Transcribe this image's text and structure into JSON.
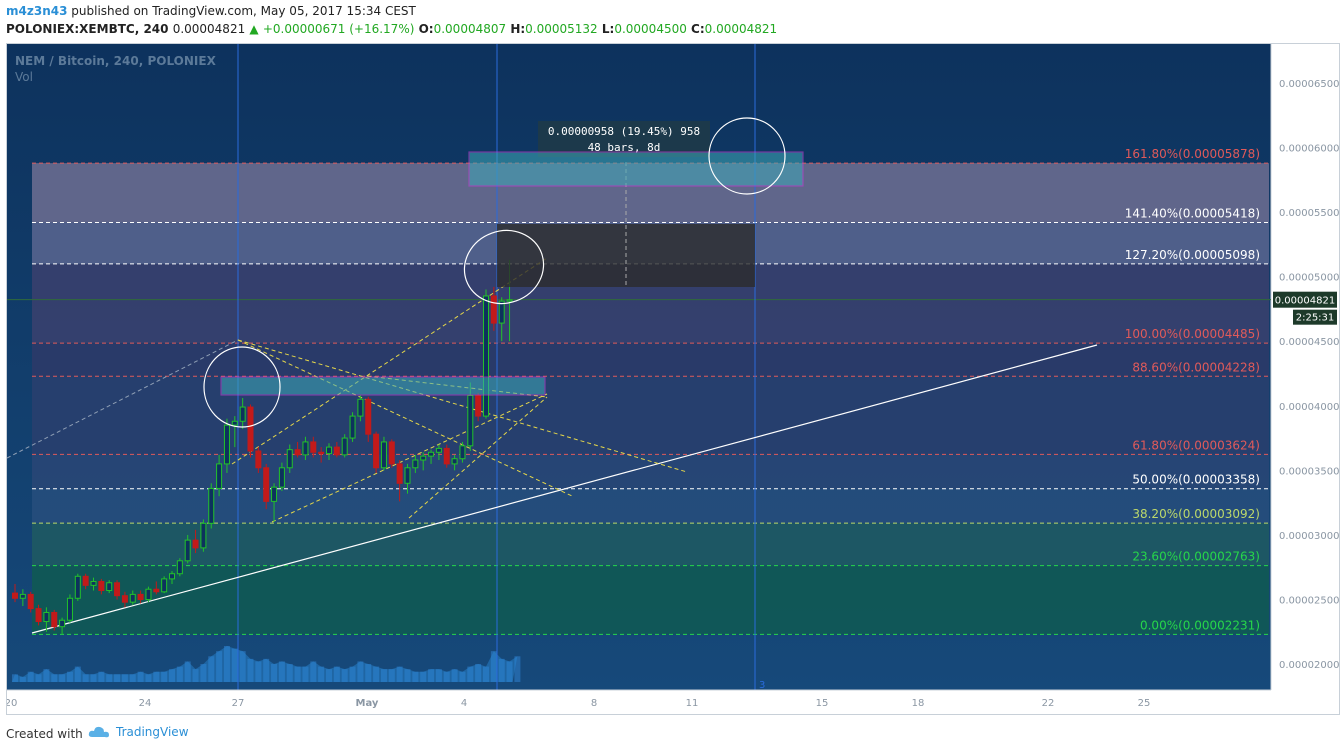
{
  "header": {
    "user": "m4z3n43",
    "published_text": "published on TradingView.com, May 05, 2017 15:34 CEST",
    "symbol": "POLONIEX:XEMBTC, 240",
    "last": "0.00004821",
    "change": "+0.00000671 (+16.17%)",
    "o_label": "O:",
    "o_value": "0.00004807",
    "h_label": "H:",
    "h_value": "0.00005132",
    "l_label": "L:",
    "l_value": "0.00004500",
    "c_label": "C:",
    "c_value": "0.00004821"
  },
  "chart": {
    "title": "NEM / Bitcoin, 240, POLONIEX",
    "vol_label": "Vol",
    "price_badge": "0.00004821",
    "timer_badge": "2:25:31",
    "measure_line1": "0.00000958 (19.45%) 958",
    "measure_line2": "48 bars, 8d",
    "marker_3": "3"
  },
  "colors": {
    "background": "#0f3a66",
    "up_candle": "#22c22a",
    "down_candle": "#c21a1a",
    "fib_red": "#e05a5a",
    "fib_white": "#ffffff",
    "fib_green": "#26d64a",
    "vertical_line": "#2a6bdb",
    "box_magenta": "#c83ad6",
    "trend_yellow": "#e6d84a"
  },
  "footer": {
    "created_with": "Created with",
    "brand": "TradingView"
  },
  "chart_data": {
    "type": "candlestick",
    "title": "NEM / Bitcoin, 240, POLONIEX",
    "x_ticks": [
      "20",
      "24",
      "27",
      "May",
      "4",
      "8",
      "11",
      "15",
      "18",
      "22",
      "25"
    ],
    "y_ticks": [
      "0.00006500",
      "0.00006000",
      "0.00005500",
      "0.00005000",
      "0.00004500",
      "0.00004000",
      "0.00003500",
      "0.00003000",
      "0.00002500",
      "0.00002000"
    ],
    "y_range": [
      1.8e-05,
      6.8e-05
    ],
    "fib_levels": [
      {
        "label": "161.80%(0.00005878)",
        "value": 5.878e-05,
        "color": "#e05a5a"
      },
      {
        "label": "141.40%(0.00005418)",
        "value": 5.418e-05,
        "color": "#ffffff"
      },
      {
        "label": "127.20%(0.00005098)",
        "value": 5.098e-05,
        "color": "#ffffff"
      },
      {
        "label": "100.00%(0.00004485)",
        "value": 4.485e-05,
        "color": "#e05a5a"
      },
      {
        "label": "88.60%(0.00004228)",
        "value": 4.228e-05,
        "color": "#e05a5a"
      },
      {
        "label": "61.80%(0.00003624)",
        "value": 3.624e-05,
        "color": "#e05a5a"
      },
      {
        "label": "50.00%(0.00003358)",
        "value": 3.358e-05,
        "color": "#ffffff"
      },
      {
        "label": "38.20%(0.00003092)",
        "value": 3.092e-05,
        "color": "#bcd86a"
      },
      {
        "label": "23.60%(0.00002763)",
        "value": 2.763e-05,
        "color": "#26d64a"
      },
      {
        "label": "0.00%(0.00002231)",
        "value": 2.231e-05,
        "color": "#26d64a"
      }
    ],
    "last_close": 4.821e-05,
    "candles": [
      {
        "o": 2.55e-05,
        "h": 2.62e-05,
        "l": 2.48e-05,
        "c": 2.51e-05
      },
      {
        "o": 2.51e-05,
        "h": 2.58e-05,
        "l": 2.45e-05,
        "c": 2.54e-05
      },
      {
        "o": 2.54e-05,
        "h": 2.56e-05,
        "l": 2.4e-05,
        "c": 2.43e-05
      },
      {
        "o": 2.43e-05,
        "h": 2.46e-05,
        "l": 2.3e-05,
        "c": 2.33e-05
      },
      {
        "o": 2.33e-05,
        "h": 2.44e-05,
        "l": 2.25e-05,
        "c": 2.4e-05
      },
      {
        "o": 2.4e-05,
        "h": 2.42e-05,
        "l": 2.26e-05,
        "c": 2.29e-05
      },
      {
        "o": 2.29e-05,
        "h": 2.36e-05,
        "l": 2.23e-05,
        "c": 2.34e-05
      },
      {
        "o": 2.34e-05,
        "h": 2.54e-05,
        "l": 2.32e-05,
        "c": 2.51e-05
      },
      {
        "o": 2.51e-05,
        "h": 2.7e-05,
        "l": 2.49e-05,
        "c": 2.68e-05
      },
      {
        "o": 2.68e-05,
        "h": 2.7e-05,
        "l": 2.58e-05,
        "c": 2.61e-05
      },
      {
        "o": 2.61e-05,
        "h": 2.67e-05,
        "l": 2.57e-05,
        "c": 2.64e-05
      },
      {
        "o": 2.64e-05,
        "h": 2.66e-05,
        "l": 2.54e-05,
        "c": 2.57e-05
      },
      {
        "o": 2.57e-05,
        "h": 2.65e-05,
        "l": 2.55e-05,
        "c": 2.63e-05
      },
      {
        "o": 2.63e-05,
        "h": 2.65e-05,
        "l": 2.5e-05,
        "c": 2.53e-05
      },
      {
        "o": 2.53e-05,
        "h": 2.56e-05,
        "l": 2.44e-05,
        "c": 2.48e-05
      },
      {
        "o": 2.48e-05,
        "h": 2.57e-05,
        "l": 2.46e-05,
        "c": 2.54e-05
      },
      {
        "o": 2.54e-05,
        "h": 2.57e-05,
        "l": 2.47e-05,
        "c": 2.5e-05
      },
      {
        "o": 2.5e-05,
        "h": 2.6e-05,
        "l": 2.48e-05,
        "c": 2.58e-05
      },
      {
        "o": 2.58e-05,
        "h": 2.64e-05,
        "l": 2.54e-05,
        "c": 2.56e-05
      },
      {
        "o": 2.56e-05,
        "h": 2.68e-05,
        "l": 2.55e-05,
        "c": 2.66e-05
      },
      {
        "o": 2.66e-05,
        "h": 2.72e-05,
        "l": 2.62e-05,
        "c": 2.7e-05
      },
      {
        "o": 2.7e-05,
        "h": 2.82e-05,
        "l": 2.68e-05,
        "c": 2.8e-05
      },
      {
        "o": 2.8e-05,
        "h": 3e-05,
        "l": 2.78e-05,
        "c": 2.96e-05
      },
      {
        "o": 2.96e-05,
        "h": 3.04e-05,
        "l": 2.86e-05,
        "c": 2.9e-05
      },
      {
        "o": 2.9e-05,
        "h": 3.12e-05,
        "l": 2.87e-05,
        "c": 3.09e-05
      },
      {
        "o": 3.09e-05,
        "h": 3.4e-05,
        "l": 3.05e-05,
        "c": 3.36e-05
      },
      {
        "o": 3.36e-05,
        "h": 3.62e-05,
        "l": 3.3e-05,
        "c": 3.55e-05
      },
      {
        "o": 3.55e-05,
        "h": 3.9e-05,
        "l": 3.48e-05,
        "c": 3.85e-05
      },
      {
        "o": 3.85e-05,
        "h": 3.92e-05,
        "l": 3.68e-05,
        "c": 3.88e-05
      },
      {
        "o": 3.88e-05,
        "h": 4.06e-05,
        "l": 3.82e-05,
        "c": 3.99e-05
      },
      {
        "o": 3.99e-05,
        "h": 4.01e-05,
        "l": 3.6e-05,
        "c": 3.65e-05
      },
      {
        "o": 3.65e-05,
        "h": 3.68e-05,
        "l": 3.48e-05,
        "c": 3.52e-05
      },
      {
        "o": 3.52e-05,
        "h": 3.55e-05,
        "l": 3.2e-05,
        "c": 3.26e-05
      },
      {
        "o": 3.26e-05,
        "h": 3.4e-05,
        "l": 3.1e-05,
        "c": 3.37e-05
      },
      {
        "o": 3.37e-05,
        "h": 3.56e-05,
        "l": 3.34e-05,
        "c": 3.52e-05
      },
      {
        "o": 3.52e-05,
        "h": 3.7e-05,
        "l": 3.48e-05,
        "c": 3.66e-05
      },
      {
        "o": 3.66e-05,
        "h": 3.72e-05,
        "l": 3.6e-05,
        "c": 3.62e-05
      },
      {
        "o": 3.62e-05,
        "h": 3.76e-05,
        "l": 3.58e-05,
        "c": 3.72e-05
      },
      {
        "o": 3.72e-05,
        "h": 3.76e-05,
        "l": 3.6e-05,
        "c": 3.64e-05
      },
      {
        "o": 3.64e-05,
        "h": 3.68e-05,
        "l": 3.56e-05,
        "c": 3.63e-05
      },
      {
        "o": 3.63e-05,
        "h": 3.71e-05,
        "l": 3.58e-05,
        "c": 3.68e-05
      },
      {
        "o": 3.68e-05,
        "h": 3.72e-05,
        "l": 3.6e-05,
        "c": 3.62e-05
      },
      {
        "o": 3.62e-05,
        "h": 3.78e-05,
        "l": 3.6e-05,
        "c": 3.75e-05
      },
      {
        "o": 3.75e-05,
        "h": 3.95e-05,
        "l": 3.72e-05,
        "c": 3.92e-05
      },
      {
        "o": 3.92e-05,
        "h": 4.08e-05,
        "l": 3.88e-05,
        "c": 4.05e-05
      },
      {
        "o": 4.05e-05,
        "h": 4.07e-05,
        "l": 3.72e-05,
        "c": 3.78e-05
      },
      {
        "o": 3.78e-05,
        "h": 3.8e-05,
        "l": 3.48e-05,
        "c": 3.52e-05
      },
      {
        "o": 3.52e-05,
        "h": 3.76e-05,
        "l": 3.5e-05,
        "c": 3.72e-05
      },
      {
        "o": 3.72e-05,
        "h": 3.74e-05,
        "l": 3.52e-05,
        "c": 3.55e-05
      },
      {
        "o": 3.55e-05,
        "h": 3.58e-05,
        "l": 3.26e-05,
        "c": 3.4e-05
      },
      {
        "o": 3.4e-05,
        "h": 3.55e-05,
        "l": 3.32e-05,
        "c": 3.52e-05
      },
      {
        "o": 3.52e-05,
        "h": 3.62e-05,
        "l": 3.48e-05,
        "c": 3.58e-05
      },
      {
        "o": 3.58e-05,
        "h": 3.64e-05,
        "l": 3.5e-05,
        "c": 3.61e-05
      },
      {
        "o": 3.61e-05,
        "h": 3.66e-05,
        "l": 3.55e-05,
        "c": 3.64e-05
      },
      {
        "o": 3.64e-05,
        "h": 3.7e-05,
        "l": 3.58e-05,
        "c": 3.67e-05
      },
      {
        "o": 3.67e-05,
        "h": 3.7e-05,
        "l": 3.52e-05,
        "c": 3.55e-05
      },
      {
        "o": 3.55e-05,
        "h": 3.62e-05,
        "l": 3.5e-05,
        "c": 3.59e-05
      },
      {
        "o": 3.59e-05,
        "h": 3.72e-05,
        "l": 3.56e-05,
        "c": 3.69e-05
      },
      {
        "o": 3.69e-05,
        "h": 4.18e-05,
        "l": 3.65e-05,
        "c": 4.08e-05
      },
      {
        "o": 4.08e-05,
        "h": 4.1e-05,
        "l": 3.88e-05,
        "c": 3.92e-05
      },
      {
        "o": 3.92e-05,
        "h": 4.9e-05,
        "l": 3.9e-05,
        "c": 4.85e-05
      },
      {
        "o": 4.85e-05,
        "h": 4.92e-05,
        "l": 4.58e-05,
        "c": 4.64e-05
      },
      {
        "o": 4.64e-05,
        "h": 4.84e-05,
        "l": 4.5e-05,
        "c": 4.81e-05
      },
      {
        "o": 4.81e-05,
        "h": 5.13e-05,
        "l": 4.5e-05,
        "c": 4.82e-05
      }
    ],
    "volumes": [
      3,
      2,
      4,
      3,
      5,
      3,
      3,
      4,
      6,
      3,
      3,
      4,
      3,
      3,
      3,
      3,
      4,
      3,
      4,
      4,
      5,
      6,
      8,
      5,
      7,
      10,
      12,
      14,
      13,
      12,
      9,
      8,
      9,
      7,
      8,
      7,
      6,
      6,
      8,
      6,
      5,
      6,
      5,
      6,
      8,
      7,
      6,
      5,
      5,
      6,
      5,
      4,
      4,
      5,
      5,
      4,
      5,
      4,
      6,
      7,
      6,
      12,
      9,
      8,
      10
    ]
  }
}
